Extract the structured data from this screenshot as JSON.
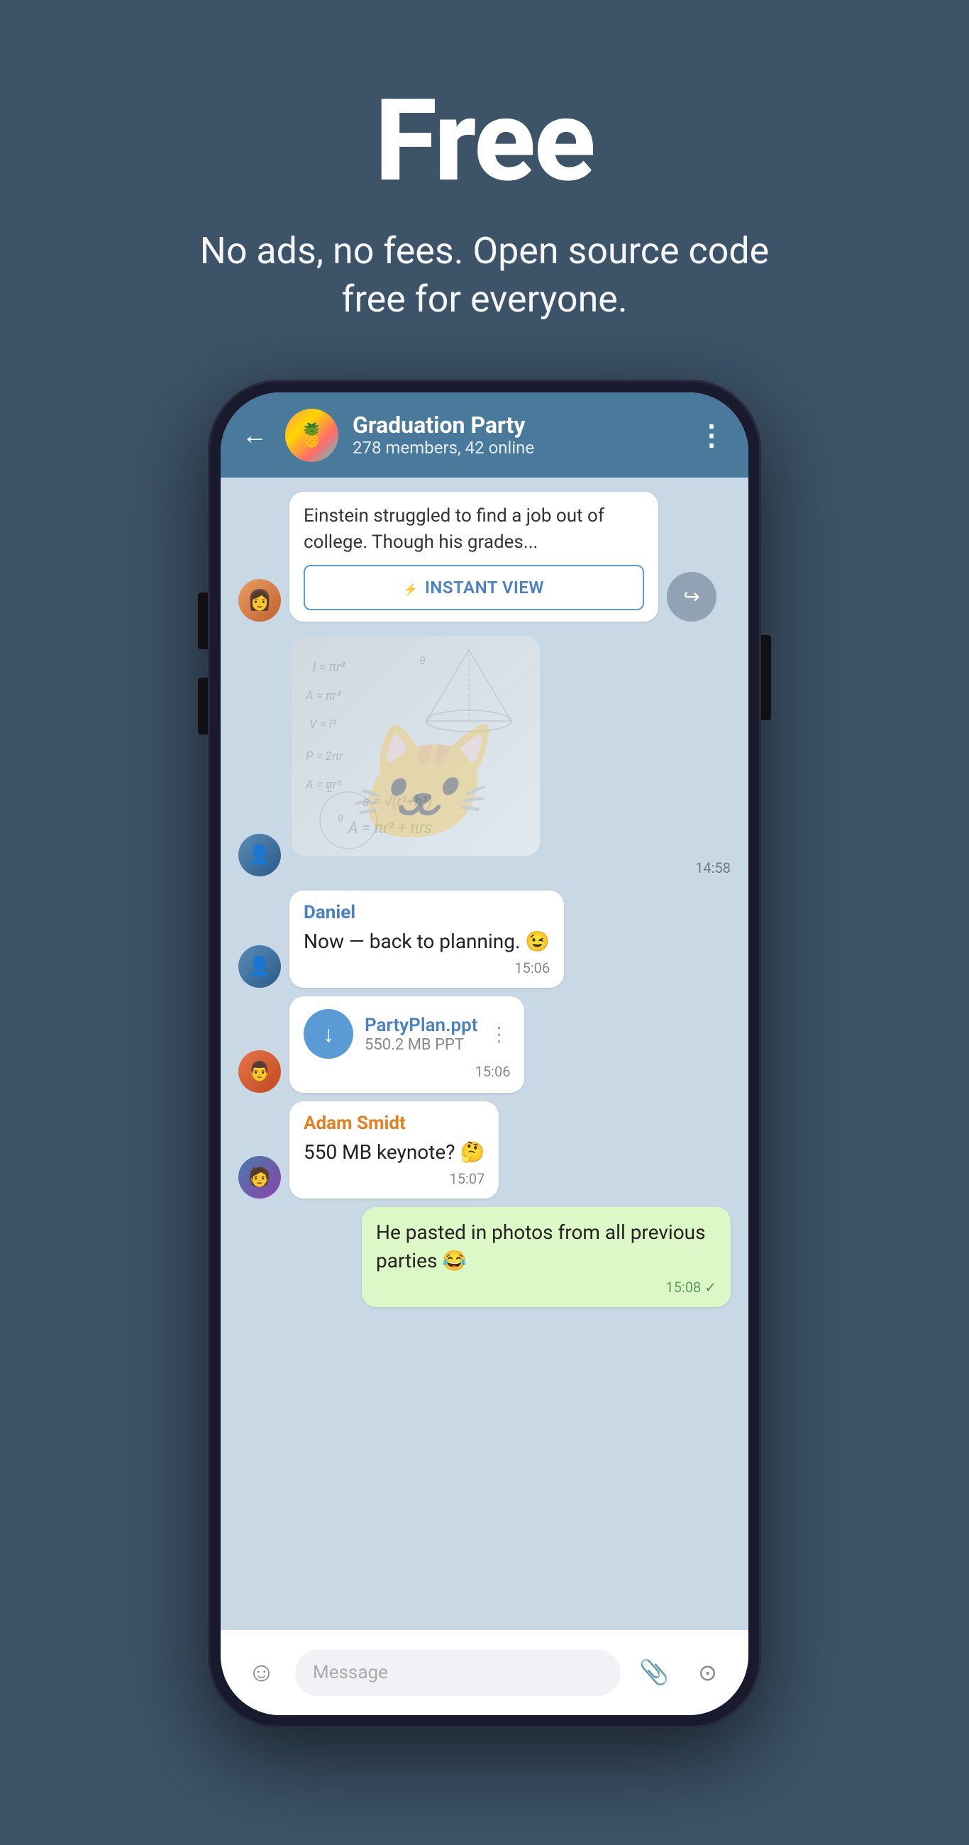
{
  "hero": {
    "title": "Free",
    "subtitle": "No ads, no fees. Open source code free for everyone."
  },
  "phone": {
    "header": {
      "group_name": "Graduation Party",
      "group_info": "278 members, 42 online",
      "back_label": "←",
      "menu_label": "⋮"
    },
    "messages": [
      {
        "type": "instant_view",
        "text": "Einstein struggled to find a job out of college. Though his grades...",
        "button_label": "INSTANT VIEW",
        "share": true
      },
      {
        "type": "sticker",
        "time": "14:58"
      },
      {
        "type": "text",
        "sender": "Daniel",
        "text": "Now — back to planning. 😉",
        "time": "15:06"
      },
      {
        "type": "file",
        "filename": "PartyPlan.ppt",
        "size": "550.2 MB PPT",
        "time": "15:06"
      },
      {
        "type": "text",
        "sender": "Adam Smidt",
        "text": "550 MB keynote? 🤔",
        "time": "15:07"
      },
      {
        "type": "outgoing",
        "text": "He pasted in photos from all previous parties 😂",
        "time": "15:08",
        "read": true
      }
    ],
    "input_placeholder": "Message",
    "icons": {
      "emoji": "☺",
      "attach": "📎",
      "camera": "⊙"
    }
  },
  "colors": {
    "background": "#3d5368",
    "phone_dark": "#1a1a2e",
    "header_blue": "#4a7a9b",
    "chat_bg": "#c8d8e4",
    "outgoing_bubble": "#dcf8c6",
    "name_blue": "#4a80c4",
    "name_orange": "#e67e22"
  }
}
